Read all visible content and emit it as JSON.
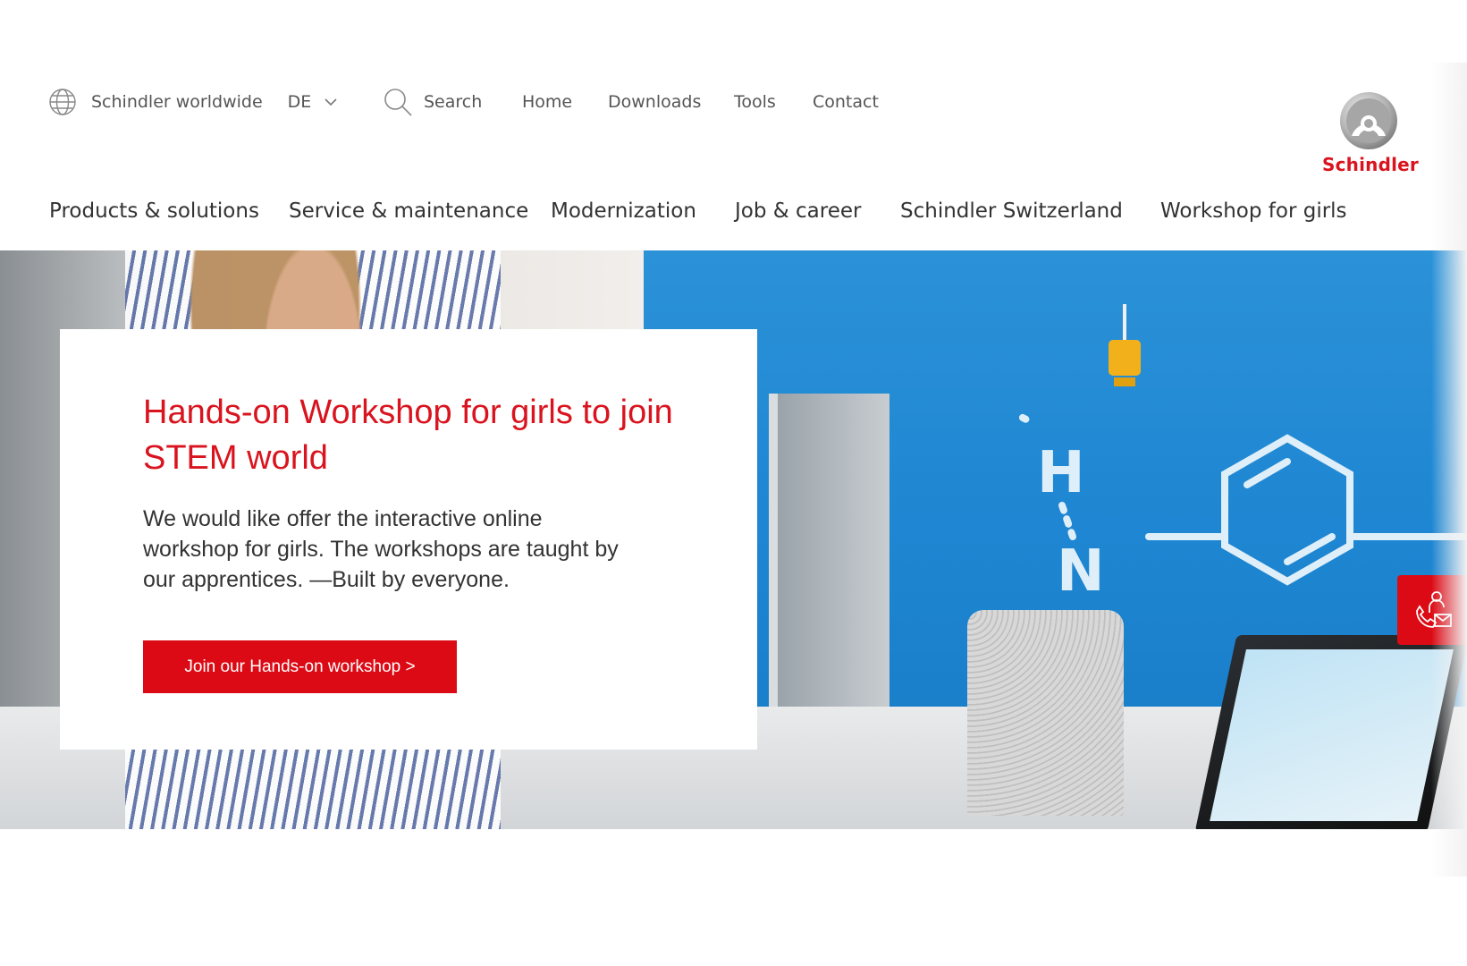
{
  "utility_bar": {
    "worldwide_label": "Schindler worldwide",
    "language": "DE",
    "search_label": "Search",
    "links": [
      "Home",
      "Downloads",
      "Tools",
      "Contact"
    ]
  },
  "brand": {
    "logo_text": "Schindler",
    "accent_color": "#dc0a14"
  },
  "main_nav": {
    "items": [
      "Products & solutions",
      "Service & maintenance",
      "Modernization",
      "Job & career",
      "Schindler Switzerland",
      "Workshop for girls"
    ]
  },
  "hero": {
    "title": "Hands-on Workshop for girls to join STEM world",
    "body": "We would like offer the interactive online workshop for girls. The workshops are taught by our apprentices. —Built by everyone.",
    "cta_label": "Join our Hands-on workshop >"
  },
  "icons": {
    "globe": "globe-icon",
    "chevron": "chevron-down-icon",
    "search": "search-icon",
    "contact": "contact-phone-mail-icon"
  }
}
